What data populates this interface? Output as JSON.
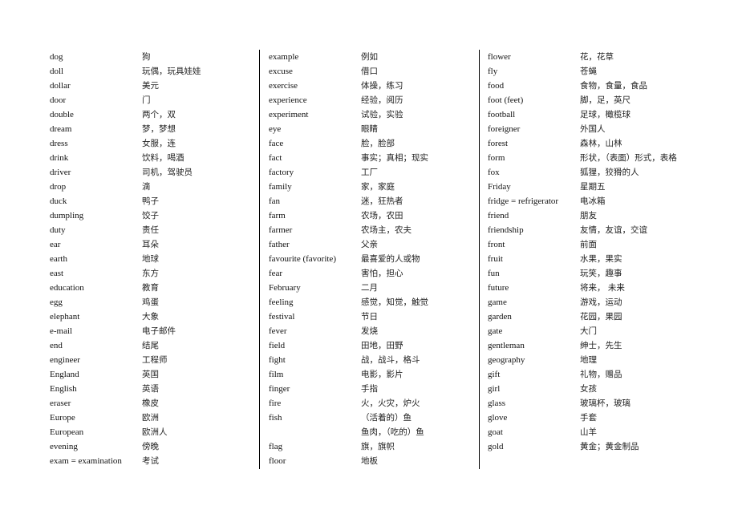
{
  "columns": [
    [
      [
        "dog",
        "狗"
      ],
      [
        "doll",
        "玩偶，玩具娃娃"
      ],
      [
        "dollar",
        "美元"
      ],
      [
        "door",
        "门"
      ],
      [
        "double",
        "两个，双"
      ],
      [
        "dream",
        "梦，梦想"
      ],
      [
        "dress",
        "女服，连"
      ],
      [
        "drink",
        "饮料，喝酒"
      ],
      [
        "driver",
        "司机，驾驶员"
      ],
      [
        "drop",
        "滴"
      ],
      [
        "duck",
        "鸭子"
      ],
      [
        "dumpling",
        "饺子"
      ],
      [
        "duty",
        "责任"
      ],
      [
        "ear",
        "耳朵"
      ],
      [
        "earth",
        "地球"
      ],
      [
        "east",
        "东方"
      ],
      [
        "education",
        "教育"
      ],
      [
        "egg",
        "鸡蛋"
      ],
      [
        "elephant",
        "大象"
      ],
      [
        "e-mail",
        "电子邮件"
      ],
      [
        "end",
        "结尾"
      ],
      [
        "engineer",
        "工程师"
      ],
      [
        "England",
        "英国"
      ],
      [
        "English",
        "英语"
      ],
      [
        "eraser",
        "橡皮"
      ],
      [
        "Europe",
        "欧洲"
      ],
      [
        "European",
        "欧洲人"
      ],
      [
        "evening",
        "傍晚"
      ],
      [
        "exam = examination",
        "考试"
      ]
    ],
    [
      [
        "example",
        "例如"
      ],
      [
        "excuse",
        "借口"
      ],
      [
        "exercise",
        "体操，练习"
      ],
      [
        "experience",
        "经验，阅历"
      ],
      [
        "experiment",
        "试验，实验"
      ],
      [
        "eye",
        "眼睛"
      ],
      [
        "face",
        "脸，脸部"
      ],
      [
        "fact",
        "事实；真相；现实"
      ],
      [
        "factory",
        "工厂"
      ],
      [
        "family",
        "家，家庭"
      ],
      [
        "fan",
        "迷，狂热者"
      ],
      [
        "farm",
        "农场，农田"
      ],
      [
        "farmer",
        "农场主，农夫"
      ],
      [
        "father",
        "父亲"
      ],
      [
        "favourite (favorite)",
        "最喜爱的人或物"
      ],
      [
        "fear",
        "害怕，担心"
      ],
      [
        "February",
        "二月"
      ],
      [
        "feeling",
        "感觉，知觉，触觉"
      ],
      [
        "festival",
        "节日"
      ],
      [
        "fever",
        "发烧"
      ],
      [
        "field",
        "田地，田野"
      ],
      [
        "fight",
        "战，战斗，格斗"
      ],
      [
        "film",
        "电影，影片"
      ],
      [
        "finger",
        "手指"
      ],
      [
        "fire",
        "火，火灾，炉火"
      ],
      [
        "fish",
        "（活着的）鱼"
      ],
      [
        "",
        "鱼肉，（吃的）鱼"
      ],
      [
        "flag",
        "旗，旗帜"
      ],
      [
        "floor",
        "地板"
      ]
    ],
    [
      [
        "flower",
        "花，花草"
      ],
      [
        "fly",
        "苍蝇"
      ],
      [
        "food",
        "食物，食量，食品"
      ],
      [
        "foot (feet)",
        "脚，足，英尺"
      ],
      [
        "football",
        "足球，橄榄球"
      ],
      [
        "foreigner",
        "外国人"
      ],
      [
        "forest",
        "森林，山林"
      ],
      [
        "form",
        "形状，（表面）形式，表格"
      ],
      [
        "fox",
        "狐狸，狡猾的人"
      ],
      [
        "Friday",
        "星期五"
      ],
      [
        "fridge = refrigerator",
        "电冰箱"
      ],
      [
        "friend",
        "朋友"
      ],
      [
        "friendship",
        "友情，友谊，交谊"
      ],
      [
        "front",
        "前面"
      ],
      [
        "fruit",
        "水果，果实"
      ],
      [
        "fun",
        "玩笑，趣事"
      ],
      [
        "future",
        "将来，  未来"
      ],
      [
        "game",
        "游戏，运动"
      ],
      [
        "garden",
        "花园，果园"
      ],
      [
        "gate",
        "大门"
      ],
      [
        "gentleman",
        "绅士，先生"
      ],
      [
        "geography",
        "地理"
      ],
      [
        "gift",
        "礼物，赠品"
      ],
      [
        "girl",
        "女孩"
      ],
      [
        "glass",
        "玻璃杯，玻璃"
      ],
      [
        "glove",
        "手套"
      ],
      [
        "goat",
        "山羊"
      ],
      [
        "gold",
        "黄金；黄金制品"
      ]
    ]
  ]
}
